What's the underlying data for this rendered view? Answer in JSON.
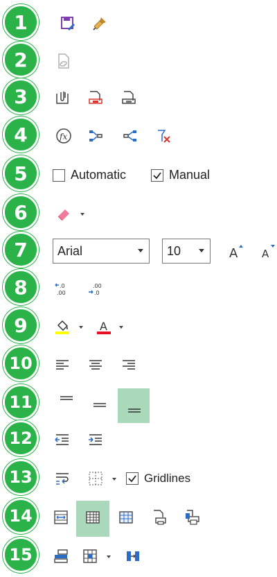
{
  "badges": [
    "1",
    "2",
    "3",
    "4",
    "5",
    "6",
    "7",
    "8",
    "9",
    "10",
    "11",
    "12",
    "13",
    "14",
    "15"
  ],
  "calc_options": {
    "automatic_label": "Automatic",
    "automatic_checked": false,
    "manual_label": "Manual",
    "manual_checked": true
  },
  "font": {
    "family": "Arial",
    "size": "10"
  },
  "gridlines": {
    "label": "Gridlines",
    "checked": true
  },
  "colors": {
    "badge_green": "#2bb34a",
    "selected_highlight": "#a9d8bb",
    "highlight_yellow": "#ffff00",
    "font_red": "#e81123",
    "icon_blue": "#2b6cc4"
  },
  "icons": {
    "row1": [
      "save-edit-icon",
      "format-painter-icon"
    ],
    "row2": [
      "link-document-icon"
    ],
    "row3": [
      "attach-file-icon",
      "attach-red-icon",
      "attach-gray-icon"
    ],
    "row4": [
      "function-fx-icon",
      "trace-precedents-icon",
      "trace-dependents-icon",
      "remove-arrows-icon"
    ],
    "row6": [
      "eraser-icon"
    ],
    "row7": [
      "increase-font-icon",
      "decrease-font-icon"
    ],
    "row8": [
      "increase-decimal-icon",
      "decrease-decimal-icon"
    ],
    "row9": [
      "fill-color-icon",
      "font-color-icon"
    ],
    "row10": [
      "align-left-icon",
      "align-center-icon",
      "align-right-icon"
    ],
    "row11": [
      "align-top-icon",
      "align-middle-icon",
      "align-bottom-icon"
    ],
    "row12": [
      "decrease-indent-icon",
      "increase-indent-icon"
    ],
    "row13": [
      "wrap-text-icon",
      "borders-icon"
    ],
    "row14": [
      "fit-width-icon",
      "normal-view-icon",
      "page-layout-icon",
      "print-preview-icon",
      "print-icon"
    ],
    "row15": [
      "merge-cells-icon",
      "table-style-icon",
      "distribute-icon"
    ]
  }
}
